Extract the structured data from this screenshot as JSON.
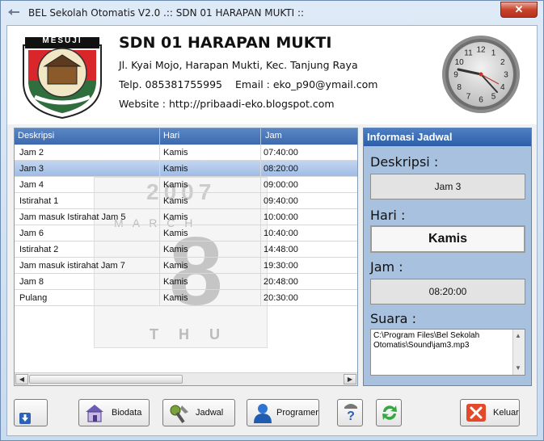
{
  "window": {
    "title": "BEL Sekolah Otomatis V2.0    .:: SDN 01 HARAPAN MUKTI ::",
    "close_label": "✕"
  },
  "header": {
    "logo_text": "MESUJI",
    "school_name": "SDN 01 HARAPAN MUKTI",
    "address": "Jl. Kyai Mojo, Harapan Mukti, Kec. Tanjung Raya",
    "phone": "Telp. 085381755995",
    "email": "Email : eko_p90@ymail.com",
    "website": "Website : http://pribaadi-eko.blogspot.com",
    "clock_numbers": [
      "12",
      "1",
      "2",
      "3",
      "4",
      "5",
      "6",
      "7",
      "8",
      "9",
      "10",
      "11"
    ]
  },
  "table": {
    "columns": [
      "Deskripsi",
      "Hari",
      "Jam"
    ],
    "rows": [
      {
        "desc": "Jam 2",
        "hari": "Kamis",
        "jam": "07:40:00"
      },
      {
        "desc": "Jam 3",
        "hari": "Kamis",
        "jam": "08:20:00"
      },
      {
        "desc": "Jam 4",
        "hari": "Kamis",
        "jam": "09:00:00"
      },
      {
        "desc": "Istirahat 1",
        "hari": "Kamis",
        "jam": "09:40:00"
      },
      {
        "desc": "Jam masuk Istirahat Jam 5",
        "hari": "Kamis",
        "jam": "10:00:00"
      },
      {
        "desc": "Jam 6",
        "hari": "Kamis",
        "jam": "10:40:00"
      },
      {
        "desc": "Istirahat 2",
        "hari": "Kamis",
        "jam": "14:48:00"
      },
      {
        "desc": "Jam masuk istirahat Jam 7",
        "hari": "Kamis",
        "jam": "19:30:00"
      },
      {
        "desc": "Jam 8",
        "hari": "Kamis",
        "jam": "20:48:00"
      },
      {
        "desc": "Pulang",
        "hari": "Kamis",
        "jam": "20:30:00"
      }
    ],
    "selected_index": 1,
    "watermark": {
      "year": "2007",
      "month": "M A R C H",
      "day": "8",
      "weekday": "T H U"
    }
  },
  "info": {
    "title": "Informasi Jadwal",
    "deskripsi_label": "Deskripsi :",
    "deskripsi_value": "Jam 3",
    "hari_label": "Hari :",
    "hari_value": "Kamis",
    "jam_label": "Jam :",
    "jam_value": "08:20:00",
    "suara_label": "Suara :",
    "suara_value": "C:\\Program Files\\Bel Sekolah Otomatis\\Sound\\jam3.mp3"
  },
  "buttons": {
    "biodata": "Biodata",
    "jadwal": "Jadwal",
    "programer": "Programer",
    "keluar": "Keluar"
  },
  "colors": {
    "header_blue": "#3c6aae",
    "selection": "#9fbbe5",
    "info_bg": "#a8c1df"
  }
}
